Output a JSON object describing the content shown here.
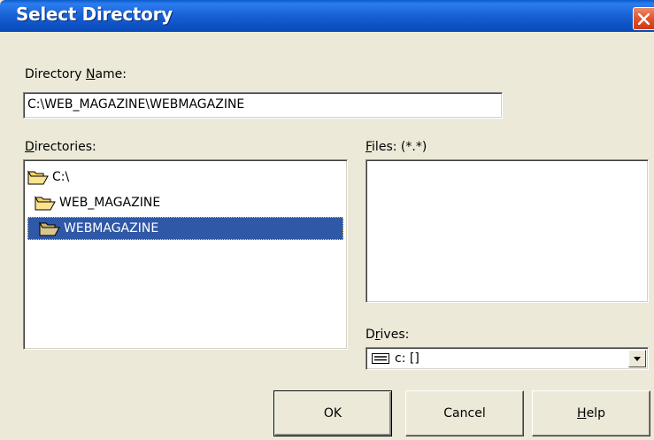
{
  "window": {
    "title": "Select Directory"
  },
  "directory_name": {
    "label_prefix": "Directory ",
    "label_accel": "N",
    "label_suffix": "ame:",
    "value": "C:\\WEB_MAGAZINE\\WEBMAGAZINE"
  },
  "directories": {
    "label_accel": "D",
    "label_suffix": "irectories:",
    "items": [
      {
        "label": "C:\\",
        "icon": "open-folder-icon",
        "selected": false
      },
      {
        "label": "WEB_MAGAZINE",
        "icon": "open-folder-icon",
        "selected": false
      },
      {
        "label": "WEBMAGAZINE",
        "icon": "open-folder-icon",
        "selected": true
      }
    ]
  },
  "files": {
    "label_accel": "F",
    "label_suffix": "iles: (*.*)"
  },
  "drives": {
    "label_prefix": "D",
    "label_accel": "r",
    "label_suffix": "ives:",
    "selected": "c: []",
    "icon": "drive-icon"
  },
  "buttons": {
    "ok": "OK",
    "cancel": "Cancel",
    "help_accel": "H",
    "help_suffix": "elp"
  },
  "colors": {
    "titlebar": "#0a5cc9",
    "selection": "#2f58a6",
    "dialog_bg": "#ece9d8",
    "folder": "#f6d36a"
  }
}
